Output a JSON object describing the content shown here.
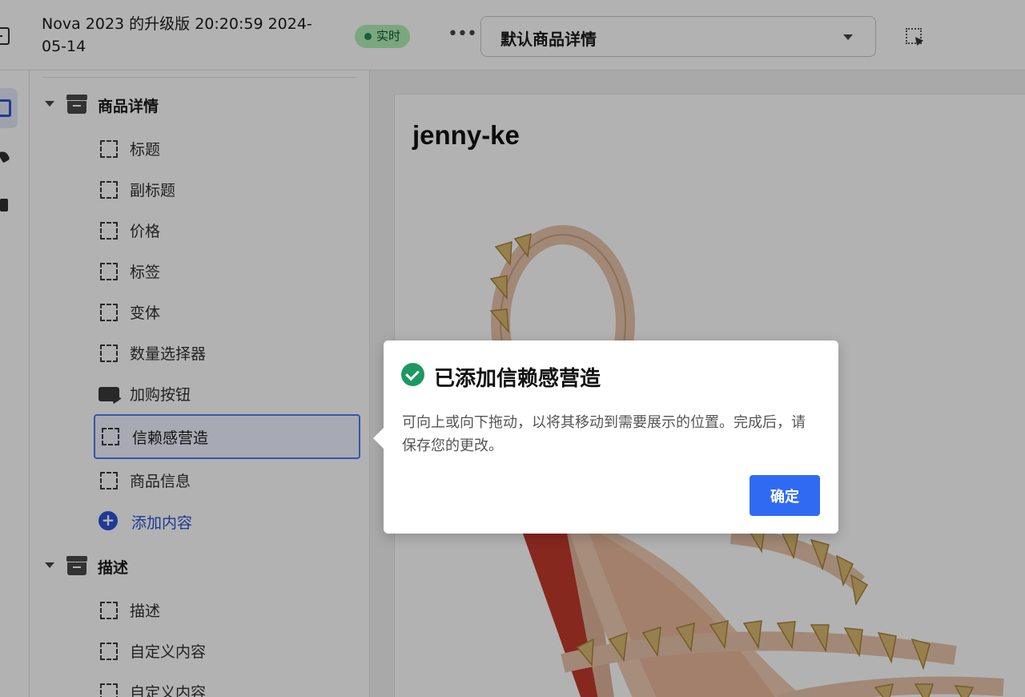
{
  "header": {
    "theme_title": "Nova 2023 的升级版 20:20:59 2024-05-14",
    "live_badge": "实时",
    "template_select": "默认商品详情"
  },
  "sidebar": {
    "groups": [
      {
        "label": "商品详情",
        "blocks": [
          "标题",
          "副标题",
          "价格",
          "标签",
          "变体",
          "数量选择器",
          "加购按钮",
          "信赖感营造",
          "商品信息"
        ],
        "add_label": "添加内容"
      },
      {
        "label": "描述",
        "blocks": [
          "描述",
          "自定义内容",
          "自定义内容"
        ]
      }
    ],
    "selected_block": "信赖感营造"
  },
  "preview": {
    "product_title": "jenny-ke"
  },
  "popover": {
    "title": "已添加信赖感营造",
    "body": "可向上或向下拖动，以将其移动到需要展示的位置。完成后，请保存您的更改。",
    "confirm_label": "确定"
  },
  "colors": {
    "accent": "#2f6bf2",
    "success": "#1d9862",
    "live_badge_bg": "#aff0b5",
    "selected_border": "#4a7cf0"
  }
}
